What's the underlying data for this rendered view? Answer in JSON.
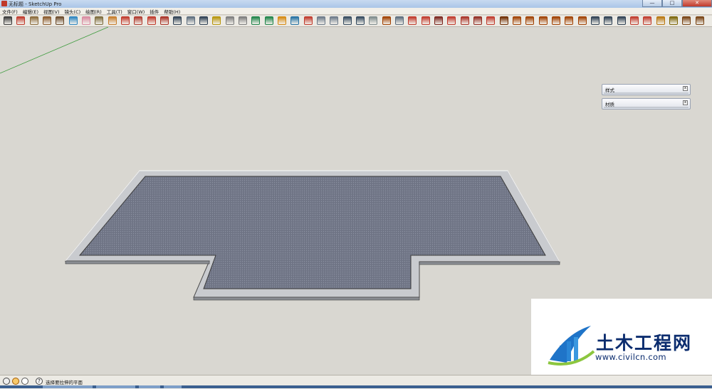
{
  "window": {
    "title": "无标题 - SketchUp Pro",
    "minimize_label": "—",
    "maximize_label": "□",
    "close_label": "✕"
  },
  "menu": {
    "items": [
      {
        "label": "文件(F)"
      },
      {
        "label": "编辑(E)"
      },
      {
        "label": "视图(V)"
      },
      {
        "label": "镜头(C)"
      },
      {
        "label": "绘图(R)"
      },
      {
        "label": "工具(T)"
      },
      {
        "label": "窗口(W)"
      },
      {
        "label": "插件"
      },
      {
        "label": "帮助(H)"
      }
    ]
  },
  "toolbar": {
    "tools": [
      {
        "name": "select-tool-icon",
        "color": "#3a3a3a"
      },
      {
        "name": "line-tool-icon",
        "color": "#c0392b"
      },
      {
        "name": "rectangle-tool-icon",
        "color": "#8b6a3a"
      },
      {
        "name": "circle-tool-icon",
        "color": "#8b5a2b"
      },
      {
        "name": "arc-tool-icon",
        "color": "#6b4a2b"
      },
      {
        "name": "make-component-icon",
        "color": "#2e86c1"
      },
      {
        "name": "eraser-tool-icon",
        "color": "#d98aa0"
      },
      {
        "name": "tape-measure-icon",
        "color": "#7d6b3c"
      },
      {
        "name": "paint-bucket-icon",
        "color": "#c77d2a"
      },
      {
        "name": "push-pull-icon",
        "color": "#c0392b"
      },
      {
        "name": "move-tool-icon",
        "color": "#b03a2e"
      },
      {
        "name": "rotate-tool-icon",
        "color": "#c0392b"
      },
      {
        "name": "offset-tool-icon",
        "color": "#a93226"
      },
      {
        "name": "orbit-tool-icon",
        "color": "#2e4053"
      },
      {
        "name": "pan-tool-icon",
        "color": "#5d6d7e"
      },
      {
        "name": "zoom-tool-icon",
        "color": "#2e4053"
      },
      {
        "name": "zoom-extents-icon",
        "color": "#b7950b"
      },
      {
        "name": "previous-view-icon",
        "color": "#7d7d7d"
      },
      {
        "name": "next-view-icon",
        "color": "#7d7d7d"
      },
      {
        "name": "get-models-icon",
        "color": "#1e8449"
      },
      {
        "name": "share-model-icon",
        "color": "#1e8449"
      },
      {
        "name": "get-components-icon",
        "color": "#d68910"
      },
      {
        "name": "share-component-icon",
        "color": "#2471a3"
      },
      {
        "name": "extension-warehouse-icon",
        "color": "#c0392b"
      },
      {
        "name": "x-ray-icon",
        "color": "#6c7a89"
      },
      {
        "name": "back-edges-icon",
        "color": "#6c7a89"
      },
      {
        "name": "wireframe-icon",
        "color": "#34495e"
      },
      {
        "name": "hidden-line-icon",
        "color": "#34495e"
      },
      {
        "name": "shaded-icon",
        "color": "#7f8c8d"
      },
      {
        "name": "shaded-textures-icon",
        "color": "#a04000"
      },
      {
        "name": "monochrome-icon",
        "color": "#5d6d7e"
      },
      {
        "name": "section-plane-icon",
        "color": "#c0392b"
      },
      {
        "name": "sandbox-from-contours-icon",
        "color": "#c0392b"
      },
      {
        "name": "sandbox-from-scratch-icon",
        "color": "#7b241c"
      },
      {
        "name": "smoove-icon",
        "color": "#c0392b"
      },
      {
        "name": "stamp-icon",
        "color": "#a93226"
      },
      {
        "name": "drape-icon",
        "color": "#922b21"
      },
      {
        "name": "add-detail-icon",
        "color": "#c0392b"
      },
      {
        "name": "flip-edge-icon",
        "color": "#6e2c00"
      },
      {
        "name": "iso-view-icon",
        "color": "#a04000"
      },
      {
        "name": "top-view-icon",
        "color": "#a04000"
      },
      {
        "name": "front-view-icon",
        "color": "#a04000"
      },
      {
        "name": "right-view-icon",
        "color": "#a04000"
      },
      {
        "name": "back-view-icon",
        "color": "#a04000"
      },
      {
        "name": "left-view-icon",
        "color": "#a04000"
      },
      {
        "name": "walk-tool-icon",
        "color": "#2e4053"
      },
      {
        "name": "look-around-icon",
        "color": "#2e4053"
      },
      {
        "name": "position-camera-icon",
        "color": "#2e4053"
      },
      {
        "name": "layers-icon",
        "color": "#c0392b"
      },
      {
        "name": "solid-tools-icon",
        "color": "#c0392b"
      },
      {
        "name": "shadows-icon",
        "color": "#b9770e"
      },
      {
        "name": "fog-icon",
        "color": "#7d6608"
      },
      {
        "name": "match-photo-icon",
        "color": "#784212"
      },
      {
        "name": "dimension-tool-icon",
        "color": "#784212"
      }
    ]
  },
  "tray": {
    "styles_label": "样式",
    "materials_label": "材质",
    "close_glyph": "x"
  },
  "watermark": {
    "name": "土木工程网",
    "url": "www.civilcn.com"
  },
  "status": {
    "hint": "选择要拉伸的平面",
    "help_glyph": "?"
  }
}
